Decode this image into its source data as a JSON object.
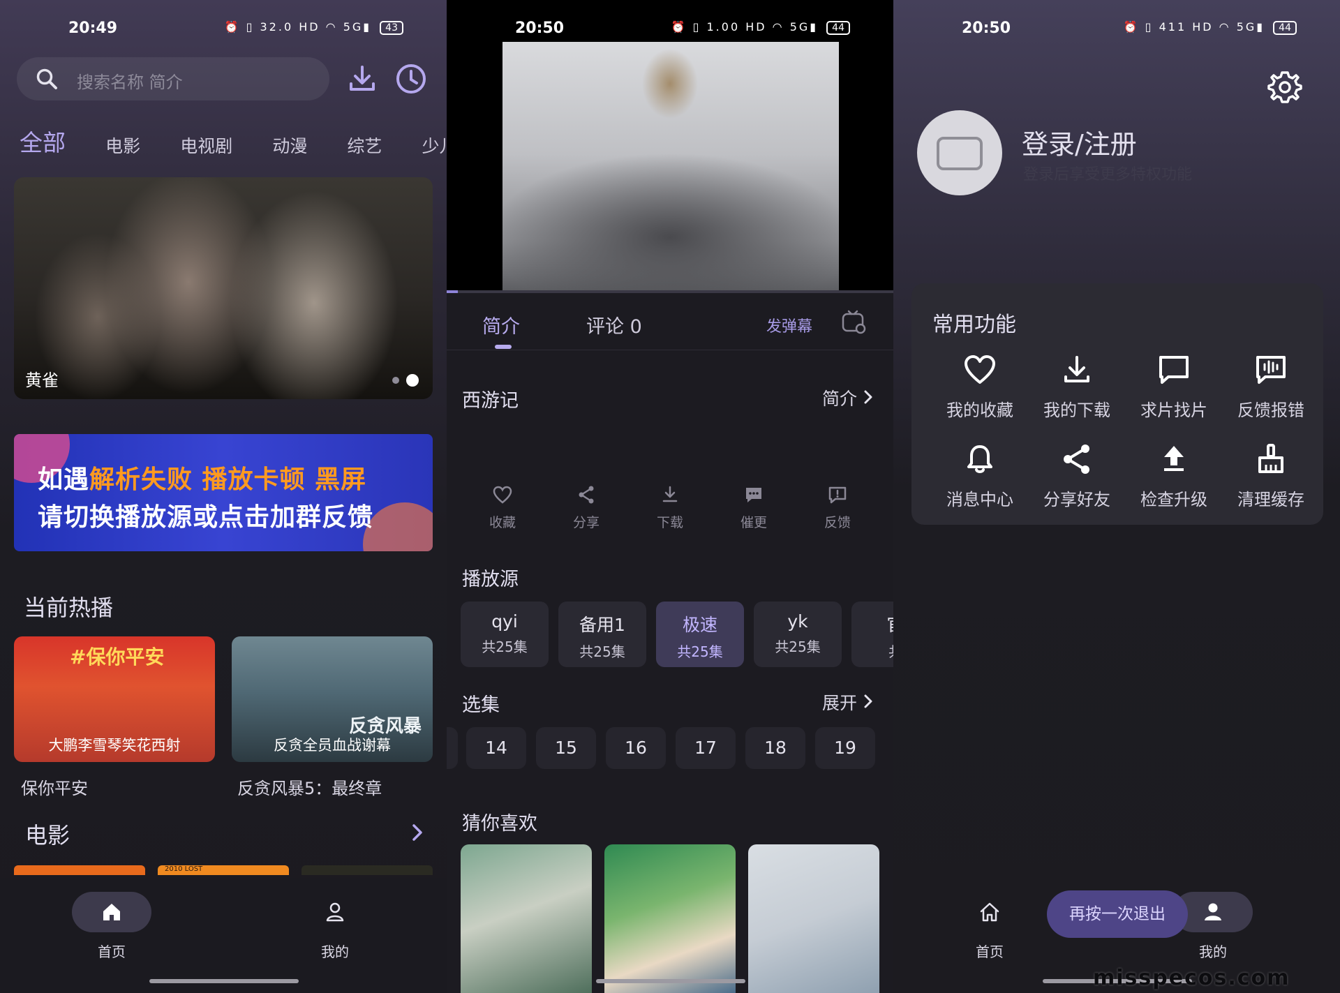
{
  "screens": {
    "home": {
      "status": {
        "time": "20:49",
        "net": "32.0",
        "battery": "43"
      },
      "search": {
        "placeholder": "搜索名称 简介"
      },
      "tabs": [
        "全部",
        "电影",
        "电视剧",
        "动漫",
        "综艺",
        "少儿"
      ],
      "hero": {
        "caption": "黄雀"
      },
      "banner": {
        "line1_a": "如遇",
        "line1_b": "解析失败 播放卡顿 黑屏",
        "line2": "请切换播放源或点击加群反馈"
      },
      "hot_title": "当前热播",
      "hot": [
        {
          "poster_text": "大鹏李雪琴笑花西射",
          "name": "保你平安",
          "poster_title": "#保你平安"
        },
        {
          "poster_text": "反贪全员血战谢幕",
          "name": "反贪风暴5：最终章",
          "poster_title": "反贪风暴"
        }
      ],
      "movie_title": "电影",
      "movie_strip": [
        "",
        "2010 LOST",
        ""
      ],
      "nav": {
        "home": "首页",
        "mine": "我的"
      }
    },
    "detail": {
      "status": {
        "time": "20:50",
        "net": "1.00",
        "battery": "44"
      },
      "tabs": {
        "intro": "简介",
        "comments": "评论 0",
        "danmu": "发弹幕"
      },
      "title": "西游记",
      "intro_link": "简介",
      "actions": [
        "收藏",
        "分享",
        "下载",
        "催更",
        "反馈"
      ],
      "source_title": "播放源",
      "sources": [
        {
          "name": "qyi",
          "count": "共25集"
        },
        {
          "name": "备用1",
          "count": "共25集"
        },
        {
          "name": "极速",
          "count": "共25集"
        },
        {
          "name": "yk",
          "count": "共25集"
        },
        {
          "name": "官",
          "count": "共"
        }
      ],
      "episodes_title": "选集",
      "expand": "展开",
      "episodes": [
        "14",
        "15",
        "16",
        "17",
        "18",
        "19"
      ],
      "guess_title": "猜你喜欢"
    },
    "profile": {
      "status": {
        "time": "20:50",
        "net": "411",
        "battery": "44"
      },
      "login": "登录/注册",
      "login_sub": "登录后享受更多特权功能",
      "common_title": "常用功能",
      "functions": [
        "我的收藏",
        "我的下载",
        "求片找片",
        "反馈报错",
        "消息中心",
        "分享好友",
        "检查升级",
        "清理缓存"
      ],
      "exit_toast": "再按一次退出",
      "nav": {
        "home": "首页",
        "mine": "我的"
      },
      "watermark": "misspecos.com"
    }
  },
  "colors": {
    "accent": "#b5a8ee",
    "toast": "#4e4587",
    "card": "#2c2b33"
  }
}
